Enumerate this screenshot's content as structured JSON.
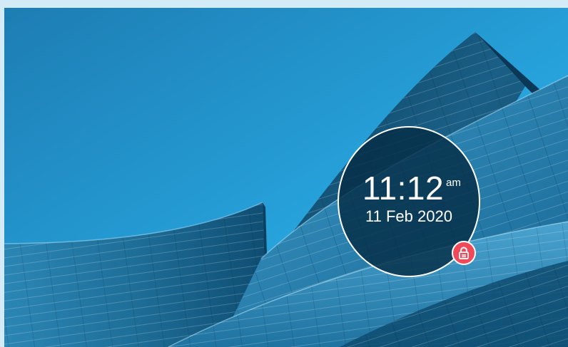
{
  "lockscreen": {
    "time": "11:12",
    "ampm": "am",
    "date": "11 Feb 2020",
    "wallpaper": "architecture-curved-facade",
    "lock_icon": "lock-icon"
  },
  "colors": {
    "sky_top": "#1f7fb4",
    "sky_bottom": "#29a9e3",
    "building_dark": "#0b4a6e",
    "building_mid": "#1f6d97",
    "building_light": "#3e97c4",
    "clock_bg": "#062f48",
    "lock_accent": "#f04a5a"
  }
}
